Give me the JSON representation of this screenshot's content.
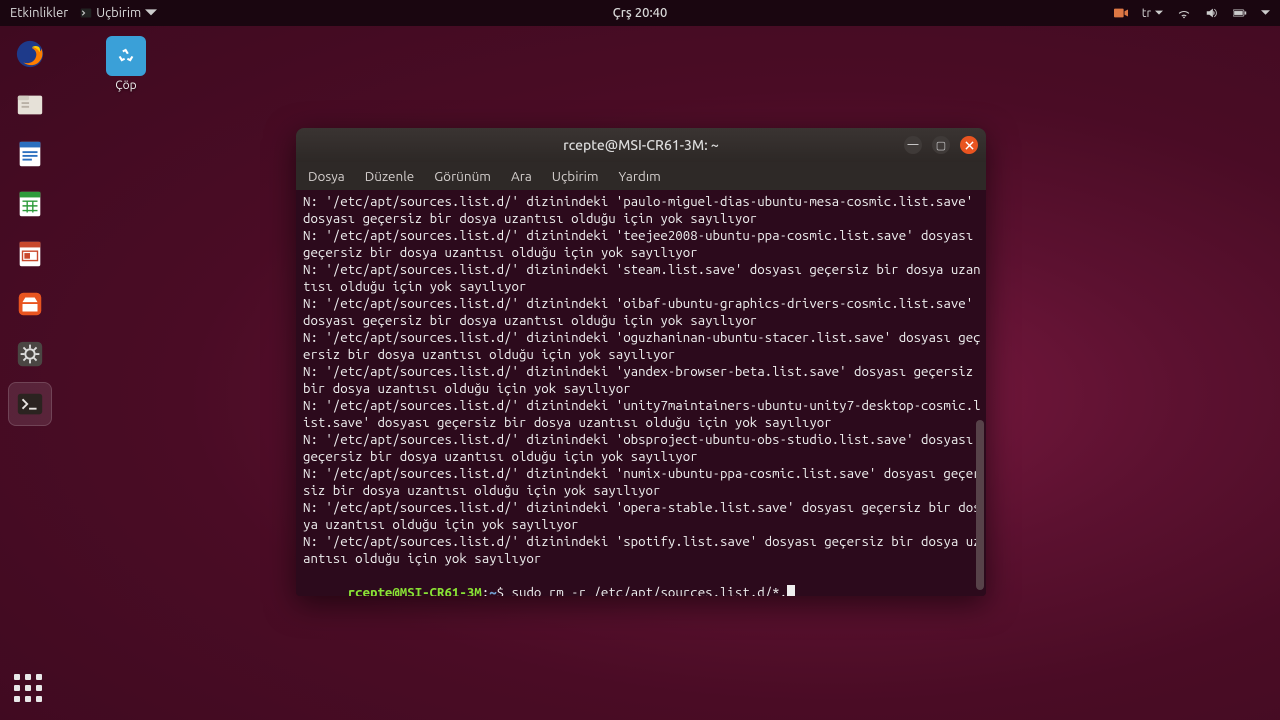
{
  "topbar": {
    "activities": "Etkinlikler",
    "active_app": "Uçbirim",
    "clock": "Çrş 20:40",
    "lang": "tr"
  },
  "trash": {
    "label": "Çöp"
  },
  "terminal": {
    "title": "rcepte@MSI-CR61-3M: ~",
    "menu": [
      "Dosya",
      "Düzenle",
      "Görünüm",
      "Ara",
      "Uçbirim",
      "Yardım"
    ],
    "lines": [
      "N: '/etc/apt/sources.list.d/' dizinindeki 'paulo-miguel-dias-ubuntu-mesa-cosmic.list.save' dosyası geçersiz bir dosya uzantısı olduğu için yok sayılıyor",
      "N: '/etc/apt/sources.list.d/' dizinindeki 'teejee2008-ubuntu-ppa-cosmic.list.save' dosyası geçersiz bir dosya uzantısı olduğu için yok sayılıyor",
      "N: '/etc/apt/sources.list.d/' dizinindeki 'steam.list.save' dosyası geçersiz bir dosya uzantısı olduğu için yok sayılıyor",
      "N: '/etc/apt/sources.list.d/' dizinindeki 'oibaf-ubuntu-graphics-drivers-cosmic.list.save' dosyası geçersiz bir dosya uzantısı olduğu için yok sayılıyor",
      "N: '/etc/apt/sources.list.d/' dizinindeki 'oguzhaninan-ubuntu-stacer.list.save' dosyası geçersiz bir dosya uzantısı olduğu için yok sayılıyor",
      "N: '/etc/apt/sources.list.d/' dizinindeki 'yandex-browser-beta.list.save' dosyası geçersiz bir dosya uzantısı olduğu için yok sayılıyor",
      "N: '/etc/apt/sources.list.d/' dizinindeki 'unity7maintainers-ubuntu-unity7-desktop-cosmic.list.save' dosyası geçersiz bir dosya uzantısı olduğu için yok sayılıyor",
      "N: '/etc/apt/sources.list.d/' dizinindeki 'obsproject-ubuntu-obs-studio.list.save' dosyası geçersiz bir dosya uzantısı olduğu için yok sayılıyor",
      "N: '/etc/apt/sources.list.d/' dizinindeki 'numix-ubuntu-ppa-cosmic.list.save' dosyası geçersiz bir dosya uzantısı olduğu için yok sayılıyor",
      "N: '/etc/apt/sources.list.d/' dizinindeki 'opera-stable.list.save' dosyası geçersiz bir dosya uzantısı olduğu için yok sayılıyor",
      "N: '/etc/apt/sources.list.d/' dizinindeki 'spotify.list.save' dosyası geçersiz bir dosya uzantısı olduğu için yok sayılıyor"
    ],
    "prompt": {
      "userhost": "rcepte@MSI-CR61-3M",
      "path": "~",
      "command": "sudo rm -r /etc/apt/sources.list.d/*."
    }
  }
}
